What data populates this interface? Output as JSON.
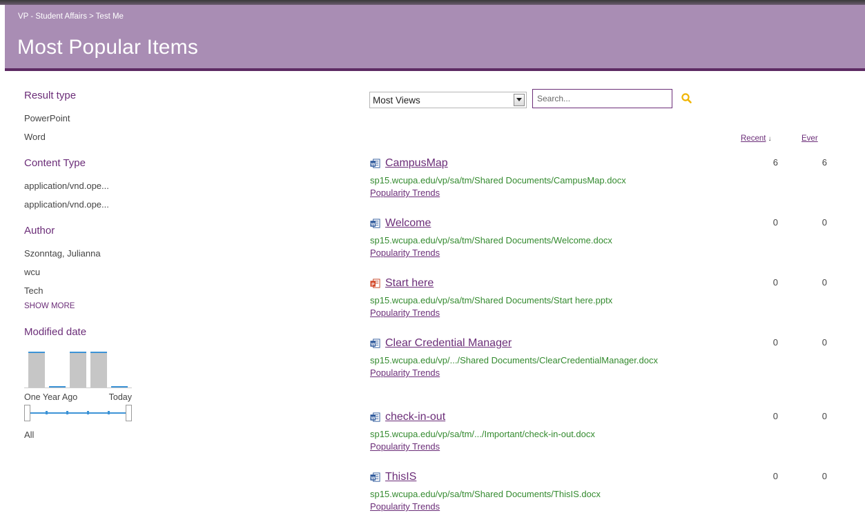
{
  "breadcrumb": {
    "parent": "VP - Student Affairs",
    "separator": ">",
    "current": "Test Me"
  },
  "page_title": "Most Popular Items",
  "refiners": {
    "result_type": {
      "title": "Result type",
      "items": [
        "PowerPoint",
        "Word"
      ]
    },
    "content_type": {
      "title": "Content Type",
      "items": [
        "application/vnd.ope...",
        "application/vnd.ope..."
      ]
    },
    "author": {
      "title": "Author",
      "items": [
        "Szonntag, Julianna",
        "wcu",
        "Tech"
      ],
      "show_more": "SHOW MORE"
    },
    "modified_date": {
      "title": "Modified date",
      "histogram_relative_heights": [
        1.0,
        0.04,
        1.0,
        1.0,
        0.04
      ],
      "start_label": "One Year Ago",
      "end_label": "Today",
      "slider_value": "All"
    }
  },
  "sort": {
    "selected": "Most Views"
  },
  "search": {
    "placeholder": "Search..."
  },
  "columns": {
    "recent": "Recent",
    "recent_sort_indicator": "↓",
    "ever": "Ever"
  },
  "results": [
    {
      "title": "CampusMap",
      "type": "word",
      "url": "sp15.wcupa.edu/vp/sa/tm/Shared Documents/CampusMap.docx",
      "trends": "Popularity Trends",
      "recent": "6",
      "ever": "6"
    },
    {
      "title": "Welcome",
      "type": "word",
      "url": "sp15.wcupa.edu/vp/sa/tm/Shared Documents/Welcome.docx",
      "trends": "Popularity Trends",
      "recent": "0",
      "ever": "0"
    },
    {
      "title": "Start here",
      "type": "powerpoint",
      "url": "sp15.wcupa.edu/vp/sa/tm/Shared Documents/Start here.pptx",
      "trends": "Popularity Trends",
      "recent": "0",
      "ever": "0"
    },
    {
      "title": "Clear Credential Manager",
      "type": "word",
      "url": "sp15.wcupa.edu/vp/.../Shared Documents/ClearCredentialManager.docx",
      "trends": "Popularity Trends",
      "recent": "0",
      "ever": "0"
    },
    {
      "title": "check-in-out",
      "type": "word",
      "url": "sp15.wcupa.edu/vp/sa/tm/.../Important/check-in-out.docx",
      "trends": "Popularity Trends",
      "recent": "0",
      "ever": "0"
    },
    {
      "title": "ThisIS",
      "type": "word",
      "url": "sp15.wcupa.edu/vp/sa/tm/Shared Documents/ThisIS.docx",
      "trends": "Popularity Trends",
      "recent": "0",
      "ever": "0"
    }
  ],
  "colors": {
    "header": "#a98db4",
    "header_border": "#5d2a63",
    "accent": "#6b2d78",
    "url_green": "#338a2e",
    "histogram_top": "#3c93d6",
    "search_icon": "#f0b400"
  }
}
